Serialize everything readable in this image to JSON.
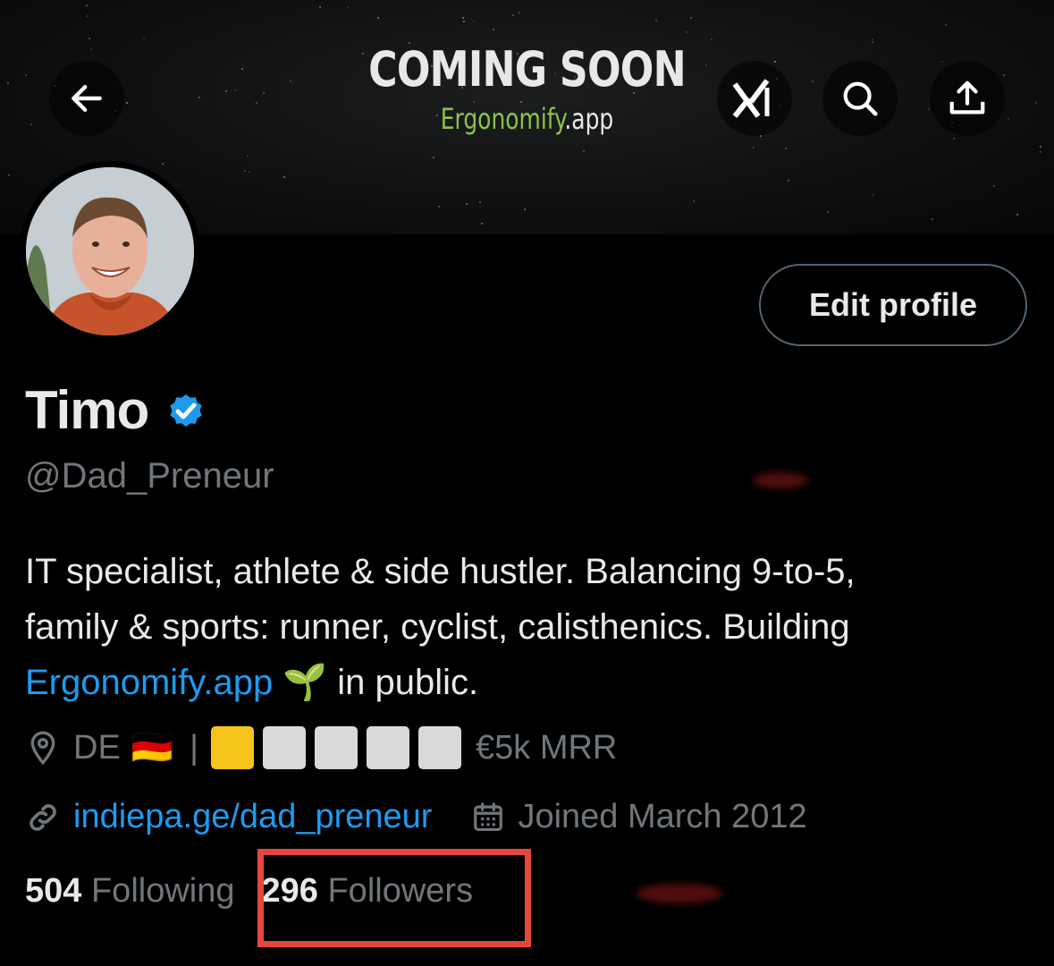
{
  "banner": {
    "title": "COMING SOON",
    "subtitle_green": "Ergonomify",
    "subtitle_white": ".app"
  },
  "header": {
    "back_icon": "arrow-left-icon",
    "grok_icon": "grok-xai-icon",
    "search_icon": "search-icon",
    "share_icon": "share-upload-icon"
  },
  "profile": {
    "name": "Timo",
    "verified_icon": "verified-badge-icon",
    "verified_color": "#1d9bf0",
    "handle": "@Dad_Preneur",
    "edit_button": "Edit profile",
    "bio_line1": "IT specialist, athlete & side hustler. Balancing 9-to-5,",
    "bio_line2": "family & sports: runner, cyclist, calisthenics. Building",
    "bio_link": "Ergonomify.app",
    "bio_emoji": "🌱",
    "bio_tail": "in public.",
    "location": "DE",
    "location_flag": "🇩🇪",
    "separator": "|",
    "progress_filled": 1,
    "progress_total": 5,
    "progress_label": "€5k MRR",
    "website": "indiepa.ge/dad_preneur",
    "joined": "Joined March 2012"
  },
  "stats": {
    "following_count": "504",
    "following_label": "Following",
    "followers_count": "296",
    "followers_label": "Followers"
  },
  "colors": {
    "accent": "#1d9bf0",
    "highlight_box": "#e5473e",
    "progress_filled": "#f6c31a",
    "progress_empty": "#d9d9d9"
  }
}
